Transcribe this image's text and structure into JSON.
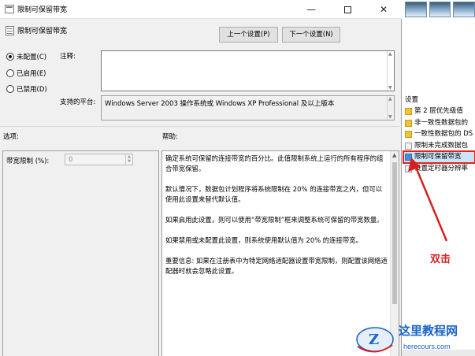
{
  "window": {
    "title": "限制可保留带宽",
    "controls": {
      "minimize": "—",
      "close": "✕"
    }
  },
  "header": {
    "policy_name": "限制可保留带宽",
    "prev_button": "上一个设置(P)",
    "next_button": "下一个设置(N)"
  },
  "state_options": [
    {
      "label": "未配置(C)",
      "checked": true
    },
    {
      "label": "已启用(E)",
      "checked": false
    },
    {
      "label": "已禁用(D)",
      "checked": false
    }
  ],
  "comment": {
    "label": "注释:",
    "value": ""
  },
  "platform": {
    "label": "支持的平台:",
    "value": "Windows Server 2003 操作系统或 Windows XP Professional 及以上版本"
  },
  "options": {
    "heading": "选项:",
    "bandwidth_label": "带宽限制 (%):",
    "bandwidth_value": "0"
  },
  "help": {
    "heading": "帮助:",
    "paragraphs": [
      "确定系统可保留的连接带宽的百分比。此值限制系统上运行的所有程序的组合带宽保留。",
      "默认情况下，数据包计划程序将系统限制在 20% 的连接带宽之内，但可以使用此设置来替代默认值。",
      "如果启用此设置，则可以使用“带宽限制”框来调整系统可保留的带宽数量。",
      "如果禁用或未配置此设置，则系统使用默认值为 20% 的连接带宽。",
      "重要信息: 如果在注册表中为特定网络适配器设置带宽限制，则配置该网络适配器时就会忽略此设置。"
    ]
  },
  "background_panel": {
    "header": "设置",
    "items": [
      {
        "label": "第 2 层优先级值",
        "icon": "folder-icon"
      },
      {
        "label": "非一致性数据包的",
        "icon": "folder-icon"
      },
      {
        "label": "一致性数据包的 DS",
        "icon": "folder-icon"
      },
      {
        "label": "限制未完成数据包",
        "icon": "policy-icon"
      },
      {
        "label": "限制可保留带宽",
        "icon": "policy-icon",
        "selected": true
      },
      {
        "label": "设置定时器分辨率",
        "icon": "policy-icon"
      }
    ]
  },
  "annotation": {
    "text": "双击",
    "color": "#d71f1f"
  },
  "watermark": {
    "title": "这里教程网",
    "url": "herecours.com",
    "color": "#1a63c7"
  }
}
